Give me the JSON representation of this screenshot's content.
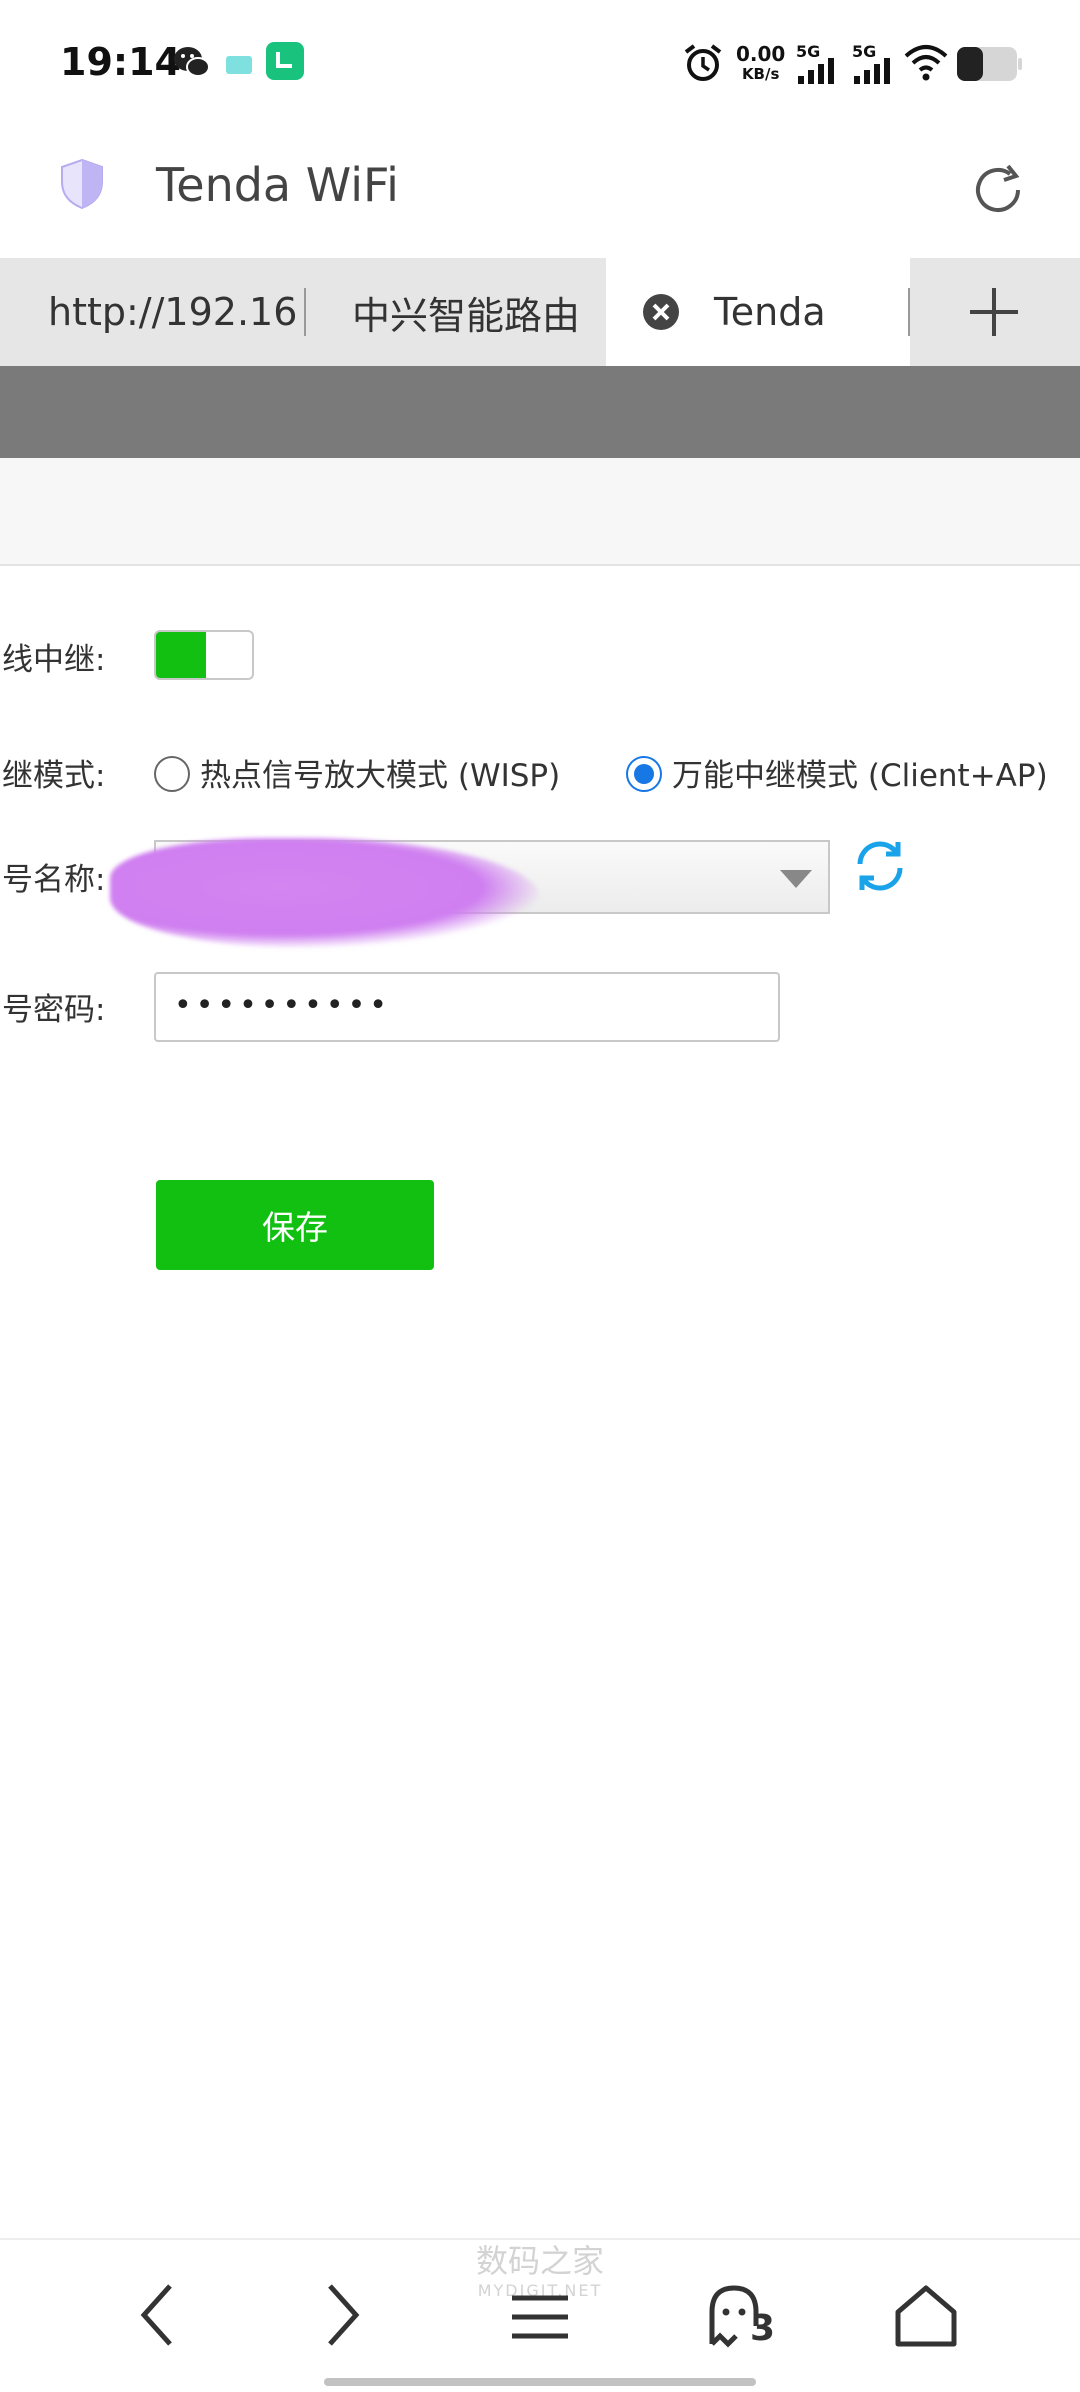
{
  "status_bar": {
    "time": "19:14",
    "speed_value": "0.00",
    "speed_unit": "KB/s",
    "network1": "5G",
    "network2": "5G"
  },
  "app": {
    "title": "Tenda WiFi"
  },
  "tabs": [
    {
      "label": "http://192.16"
    },
    {
      "label": "中兴智能路由"
    },
    {
      "label": "Tenda"
    }
  ],
  "form": {
    "wireless_relay_label": "线中继:",
    "relay_mode_label": "继模式:",
    "mode_options": [
      {
        "label": "热点信号放大模式 (WISP)",
        "selected": false
      },
      {
        "label": "万能中继模式 (Client+AP)",
        "selected": true
      }
    ],
    "ssid_label": "号名称:",
    "password_label": "号密码:",
    "password_value": "••••••••••",
    "save_label": "保存"
  },
  "bottom_nav": {
    "tab_count": "3",
    "watermark_main": "数码之家",
    "watermark_sub": "MYDIGIT.NET"
  },
  "colors": {
    "accent_green": "#11c011",
    "accent_blue": "#1677e5",
    "tab_bg": "#e6e6e6",
    "header_gray": "#7a7a7a"
  }
}
